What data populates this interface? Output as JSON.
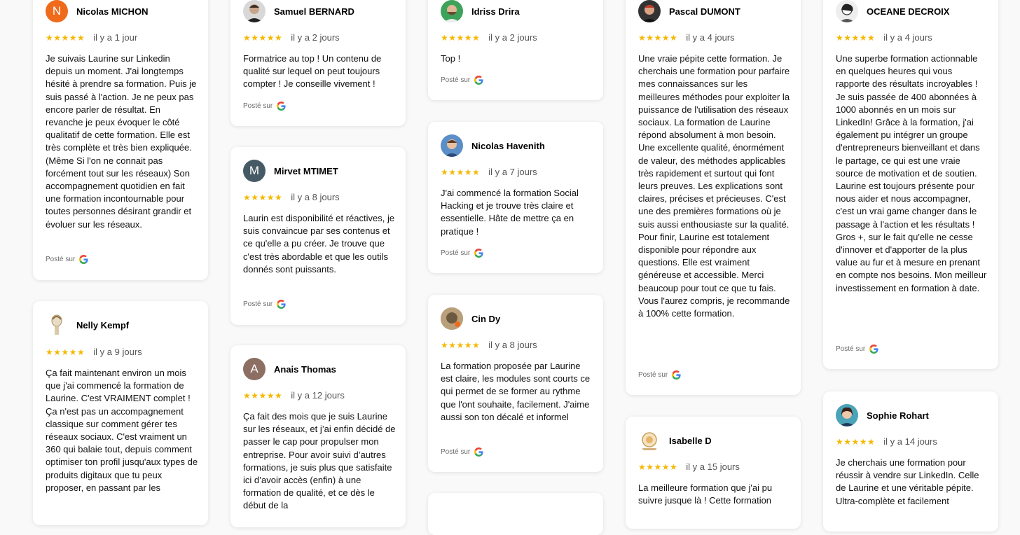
{
  "review_columns": [
    {
      "reviews": [
        {
          "name": "Nicolas MICHON",
          "avatar": "N",
          "stars": "★★★★★",
          "date": "il y a 1 jour",
          "text": "Je suivais Laurine sur Linkedin depuis un moment. J'ai longtemps hésité à prendre sa formation. Puis je suis passé à l'action. Je ne peux pas encore parler de résultat. En revanche je peux évoquer le côté qualitatif de cette formation. Elle est très complète et très bien expliquée. (Même Si l'on ne connait pas forcément tout sur les réseaux) Son accompagnement quotidien en fait une formation incontournable pour toutes personnes désirant grandir et évoluer sur les réseaux.",
          "posted": "Posté sur"
        },
        {
          "name": "Nelly Kempf",
          "avatar": "",
          "stars": "★★★★★",
          "date": "il y a 9 jours",
          "text": "Ça fait maintenant environ un mois que j'ai commencé la formation de Laurine. C'est VRAIMENT complet ! Ça n'est pas un accompagnement classique sur comment gérer tes réseaux sociaux. C'est vraiment un 360 qui balaie tout, depuis comment optimiser ton profil jusqu'aux types de produits digitaux que tu peux proposer, en passant par les",
          "posted": "Posté sur"
        }
      ]
    },
    {
      "reviews": [
        {
          "name": "Samuel BERNARD",
          "avatar": "",
          "stars": "★★★★★",
          "date": "il y a 2 jours",
          "text": "Formatrice au top ! Un contenu de qualité sur lequel on peut toujours compter ! Je conseille vivement !",
          "posted": "Posté sur"
        },
        {
          "name": "Mirvet MTIMET",
          "avatar": "M",
          "stars": "★★★★★",
          "date": "il y a 8 jours",
          "text": "Laurin est disponibilité et réactives, je suis convaincue par ses contenus et ce qu'elle a pu créer. Je trouve que c'est très abordable et que les outils donnés sont puissants.",
          "posted": "Posté sur"
        },
        {
          "name": "Anais Thomas",
          "avatar": "A",
          "stars": "★★★★★",
          "date": "il y a 12 jours",
          "text": "Ça fait des mois que je suis Laurine sur les réseaux, et j’ai enfin décidé de passer le cap pour propulser mon entreprise. Pour avoir suivi d’autres formations, je suis plus que satisfaite ici d’avoir accès (enfin) à une formation de qualité, et ce dès le début de la",
          "posted": "Posté sur"
        }
      ]
    },
    {
      "reviews": [
        {
          "name": "Idriss Drira",
          "avatar": "",
          "stars": "★★★★★",
          "date": "il y a 2 jours",
          "text": "Top !",
          "posted": "Posté sur"
        },
        {
          "name": "Nicolas Havenith",
          "avatar": "",
          "stars": "★★★★★",
          "date": "il y a 7 jours",
          "text": "J'ai commencé la formation Social Hacking et je trouve très claire et essentielle. Hâte de mettre ça en pratique !",
          "posted": "Posté sur"
        },
        {
          "name": "Cin Dy",
          "avatar": "",
          "stars": "★★★★★",
          "date": "il y a 8 jours",
          "text": "La formation proposée par Laurine est claire, les modules sont courts ce qui permet de se former au rythme que l'ont souhaite, facilement. J'aime aussi son ton décalé et informel",
          "posted": "Posté sur"
        }
      ]
    },
    {
      "reviews": [
        {
          "name": "Pascal DUMONT",
          "avatar": "",
          "stars": "★★★★★",
          "date": "il y a 4 jours",
          "text": "Une vraie pépite cette formation. Je cherchais une formation pour parfaire mes connaissances sur les meilleures méthodes pour exploiter la puissance de l'utilisation des réseaux sociaux. La formation de Laurine répond absolument à mon besoin. Une excellente qualité, énormément de valeur, des méthodes applicables très rapidement et surtout qui font leurs preuves. Les explications sont claires, précises et précieuses. C'est une des premières formations où je suis aussi enthousiaste sur la qualité. Pour finir, Laurine est totalement disponible pour répondre aux questions. Elle est vraiment généreuse et accessible. Merci beaucoup pour tout ce que tu fais. Vous l'aurez compris, je recommande à 100% cette formation.",
          "posted": "Posté sur"
        },
        {
          "name": "Isabelle D",
          "avatar": "",
          "stars": "★★★★★",
          "date": "il y a 15 jours",
          "text": "La meilleure formation que j'ai pu suivre jusque là ! Cette formation",
          "posted": "Posté sur"
        }
      ]
    },
    {
      "reviews": [
        {
          "name": "OCEANE DECROIX",
          "avatar": "",
          "stars": "★★★★★",
          "date": "il y a 4 jours",
          "text": "Une superbe formation actionnable en quelques heures qui vous rapporte des résultats incroyables ! Je suis passée de 400 abonnées à 1000 abonnés en un mois sur LinkedIn! Grâce à la formation, j'ai également pu intégrer un groupe d'entrepreneurs bienveillant et dans le partage, ce qui est une vraie source de motivation et de soutien. Laurine est toujours présente pour nous aider et nous accompagner, c'est un vrai game changer dans le passage à l'action et les résultats ! Gros +, sur le fait qu'elle ne cesse d'innover et d'apporter de la plus value au fur et à mesure en prenant en compte nos besoins. Mon meilleur investissement en formation à date.",
          "posted": "Posté sur"
        },
        {
          "name": "Sophie Rohart",
          "avatar": "",
          "stars": "★★★★★",
          "date": "il y a 14 jours",
          "text": "Je cherchais une formation pour réussir à vendre sur LinkedIn. Celle de Laurine et une véritable pépite. Ultra-complète et facilement",
          "posted": "Posté sur"
        }
      ]
    }
  ]
}
